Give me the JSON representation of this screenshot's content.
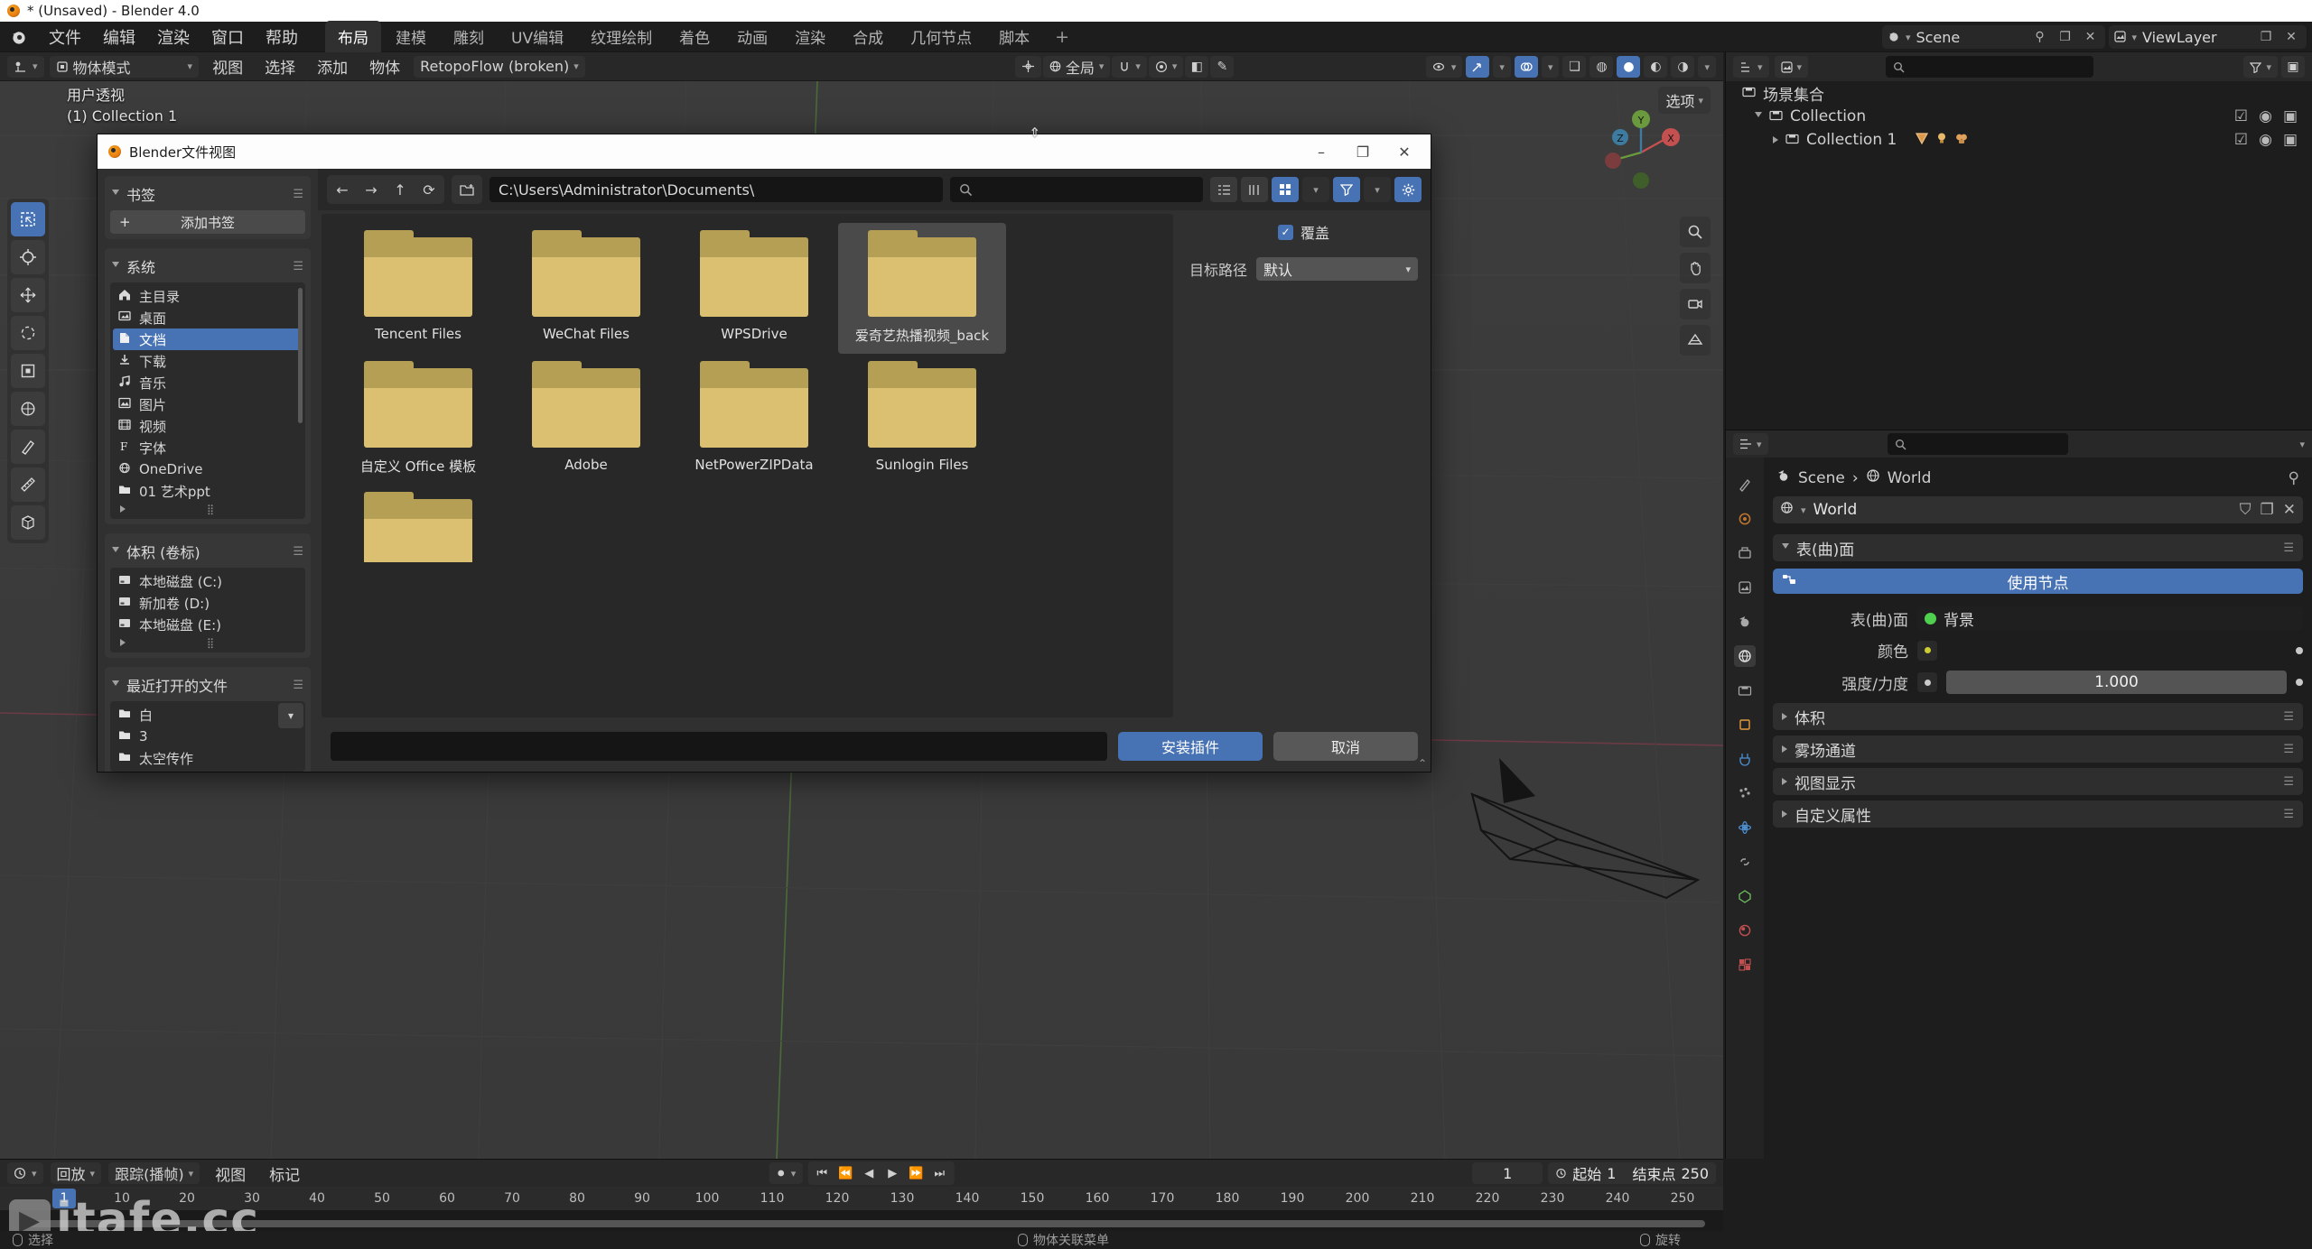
{
  "window": {
    "title": "* (Unsaved) - Blender 4.0",
    "logo_icon": "blender-logo-icon"
  },
  "topbar": {
    "menus": [
      "文件",
      "编辑",
      "渲染",
      "窗口",
      "帮助"
    ],
    "workspaces": [
      {
        "label": "布局",
        "active": true
      },
      {
        "label": "建模",
        "active": false
      },
      {
        "label": "雕刻",
        "active": false
      },
      {
        "label": "UV编辑",
        "active": false
      },
      {
        "label": "纹理绘制",
        "active": false
      },
      {
        "label": "着色",
        "active": false
      },
      {
        "label": "动画",
        "active": false
      },
      {
        "label": "渲染",
        "active": false
      },
      {
        "label": "合成",
        "active": false
      },
      {
        "label": "几何节点",
        "active": false
      },
      {
        "label": "脚本",
        "active": false
      }
    ],
    "add_workspace": "+",
    "scene_name": "Scene",
    "viewlayer_name": "ViewLayer"
  },
  "viewport_header": {
    "mode": "物体模式",
    "menus": [
      "视图",
      "选择",
      "添加",
      "物体"
    ],
    "addon_menu": "RetopoFlow (broken)",
    "transform_orientation": "全局",
    "overlay_label": "选项"
  },
  "viewport": {
    "overlay_line1": "用户透视",
    "overlay_line2": "(1) Collection 1"
  },
  "outliner": {
    "search_placeholder": "",
    "root": "场景集合",
    "rows": [
      {
        "label": "Collection",
        "indent": 1
      },
      {
        "label": "Collection 1",
        "indent": 2
      }
    ]
  },
  "properties": {
    "breadcrumb": [
      "Scene",
      "World"
    ],
    "datablock_name": "World",
    "panels": [
      {
        "label": "表(曲)面",
        "open": true
      },
      {
        "label": "体积",
        "open": false
      },
      {
        "label": "雾场通道",
        "open": false
      },
      {
        "label": "视图显示",
        "open": false
      },
      {
        "label": "自定义属性",
        "open": false
      }
    ],
    "use_nodes_label": "使用节点",
    "surface_label": "表(曲)面",
    "surface_value": "背景",
    "color_label": "颜色",
    "color_value_hex": "#cccc33",
    "strength_label": "强度/力度",
    "strength_value": "1.000"
  },
  "timeline": {
    "menus": [
      "回放",
      "跟踪(播帧)",
      "视图",
      "标记"
    ],
    "current_frame": "1",
    "start_label": "起始",
    "start_value": "1",
    "end_label": "结束点",
    "end_value": "250",
    "ticks": [
      "10",
      "20",
      "30",
      "40",
      "50",
      "60",
      "70",
      "80",
      "90",
      "100",
      "110",
      "120",
      "130",
      "140",
      "150",
      "160",
      "170",
      "180",
      "190",
      "200",
      "210",
      "220",
      "230",
      "240",
      "250"
    ],
    "playhead_label": "1"
  },
  "statusbar": {
    "items": [
      {
        "icon": "mouse-left-icon",
        "label": "选择"
      },
      {
        "icon": "mouse-right-icon",
        "label": "物体关联菜单"
      },
      {
        "icon": "mouse-middle-icon",
        "label": "旋转"
      }
    ]
  },
  "watermark": {
    "text": "itafe.cc"
  },
  "file_dialog": {
    "title": "Blender文件视图",
    "window_controls": [
      "–",
      "❐",
      "✕"
    ],
    "path_value": "C:\\Users\\Administrator\\Documents\\",
    "search_placeholder": "",
    "nav_icons": [
      "back-arrow-icon",
      "forward-arrow-icon",
      "parent-dir-icon",
      "refresh-icon",
      "new-folder-icon"
    ],
    "sidebar": {
      "bookmarks_title": "书签",
      "add_bookmark_label": "添加书签",
      "system_title": "系统",
      "system_items": [
        {
          "label": "主目录",
          "icon": "home-icon",
          "selected": false
        },
        {
          "label": "桌面",
          "icon": "desktop-icon",
          "selected": false
        },
        {
          "label": "文档",
          "icon": "documents-icon",
          "selected": true
        },
        {
          "label": "下载",
          "icon": "download-icon",
          "selected": false
        },
        {
          "label": "音乐",
          "icon": "music-icon",
          "selected": false
        },
        {
          "label": "图片",
          "icon": "image-icon",
          "selected": false
        },
        {
          "label": "视频",
          "icon": "video-icon",
          "selected": false
        },
        {
          "label": "字体",
          "icon": "font-icon",
          "selected": false
        },
        {
          "label": "OneDrive",
          "icon": "cloud-icon",
          "selected": false
        },
        {
          "label": "01 艺术ppt",
          "icon": "folder-icon",
          "selected": false
        }
      ],
      "volumes_title": "体积 (卷标)",
      "volumes": [
        {
          "label": "本地磁盘 (C:)",
          "icon": "disk-icon"
        },
        {
          "label": "新加卷 (D:)",
          "icon": "disk-icon"
        },
        {
          "label": "本地磁盘 (E:)",
          "icon": "disk-icon"
        }
      ],
      "recent_title": "最近打开的文件",
      "recent": [
        {
          "label": "白",
          "icon": "folder-icon"
        },
        {
          "label": "3",
          "icon": "folder-icon"
        },
        {
          "label": "太空传作",
          "icon": "folder-icon"
        }
      ]
    },
    "files": [
      {
        "name": "Tencent Files",
        "selected": false
      },
      {
        "name": "WeChat Files",
        "selected": false
      },
      {
        "name": "WPSDrive",
        "selected": false
      },
      {
        "name": "爱奇艺热播视频_back",
        "selected": true
      },
      {
        "name": "自定义 Office 模板",
        "selected": false
      },
      {
        "name": "Adobe",
        "selected": false
      },
      {
        "name": "NetPowerZIPData",
        "selected": false
      },
      {
        "name": "Sunlogin Files",
        "selected": false
      },
      {
        "name": "",
        "selected": false
      }
    ],
    "options": {
      "overwrite_label": "覆盖",
      "overwrite_checked": true,
      "target_path_label": "目标路径",
      "target_path_value": "默认"
    },
    "filename_value": "",
    "confirm_label": "安装插件",
    "cancel_label": "取消"
  },
  "colors": {
    "accent_blue": "#4772b3",
    "folder_front": "#dcc072",
    "folder_back": "#b59f55",
    "panel_bg": "#303030",
    "app_bg": "#1d1d1d"
  }
}
